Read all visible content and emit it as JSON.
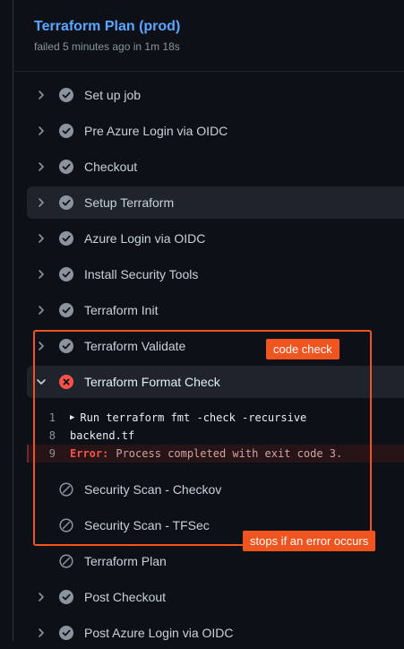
{
  "header": {
    "title": "Terraform Plan (prod)",
    "subtitle": "failed 5 minutes ago in 1m 18s"
  },
  "steps": [
    {
      "label": "Set up job",
      "status": "success"
    },
    {
      "label": "Pre Azure Login via OIDC",
      "status": "success"
    },
    {
      "label": "Checkout",
      "status": "success"
    },
    {
      "label": "Setup Terraform",
      "status": "success"
    },
    {
      "label": "Azure Login via OIDC",
      "status": "success"
    },
    {
      "label": "Install Security Tools",
      "status": "success"
    },
    {
      "label": "Terraform Init",
      "status": "success"
    },
    {
      "label": "Terraform Validate",
      "status": "success"
    },
    {
      "label": "Terraform Format Check",
      "status": "failure"
    },
    {
      "label": "Security Scan - Checkov",
      "status": "skipped"
    },
    {
      "label": "Security Scan - TFSec",
      "status": "skipped"
    },
    {
      "label": "Terraform Plan",
      "status": "skipped"
    },
    {
      "label": "Post Checkout",
      "status": "success"
    },
    {
      "label": "Post Azure Login via OIDC",
      "status": "success"
    }
  ],
  "log": [
    {
      "line": "1",
      "text": "Run terraform fmt -check -recursive"
    },
    {
      "line": "8",
      "text": "backend.tf"
    },
    {
      "line": "9",
      "prefix": "Error:",
      "text": "Process completed with exit code 3."
    }
  ],
  "annotations": {
    "code_check": "code check",
    "stops": "stops if an error occurs",
    "color": "#f0541f"
  },
  "colors": {
    "success": "#8b949e",
    "failure": "#f85149",
    "link": "#58a6ff"
  }
}
